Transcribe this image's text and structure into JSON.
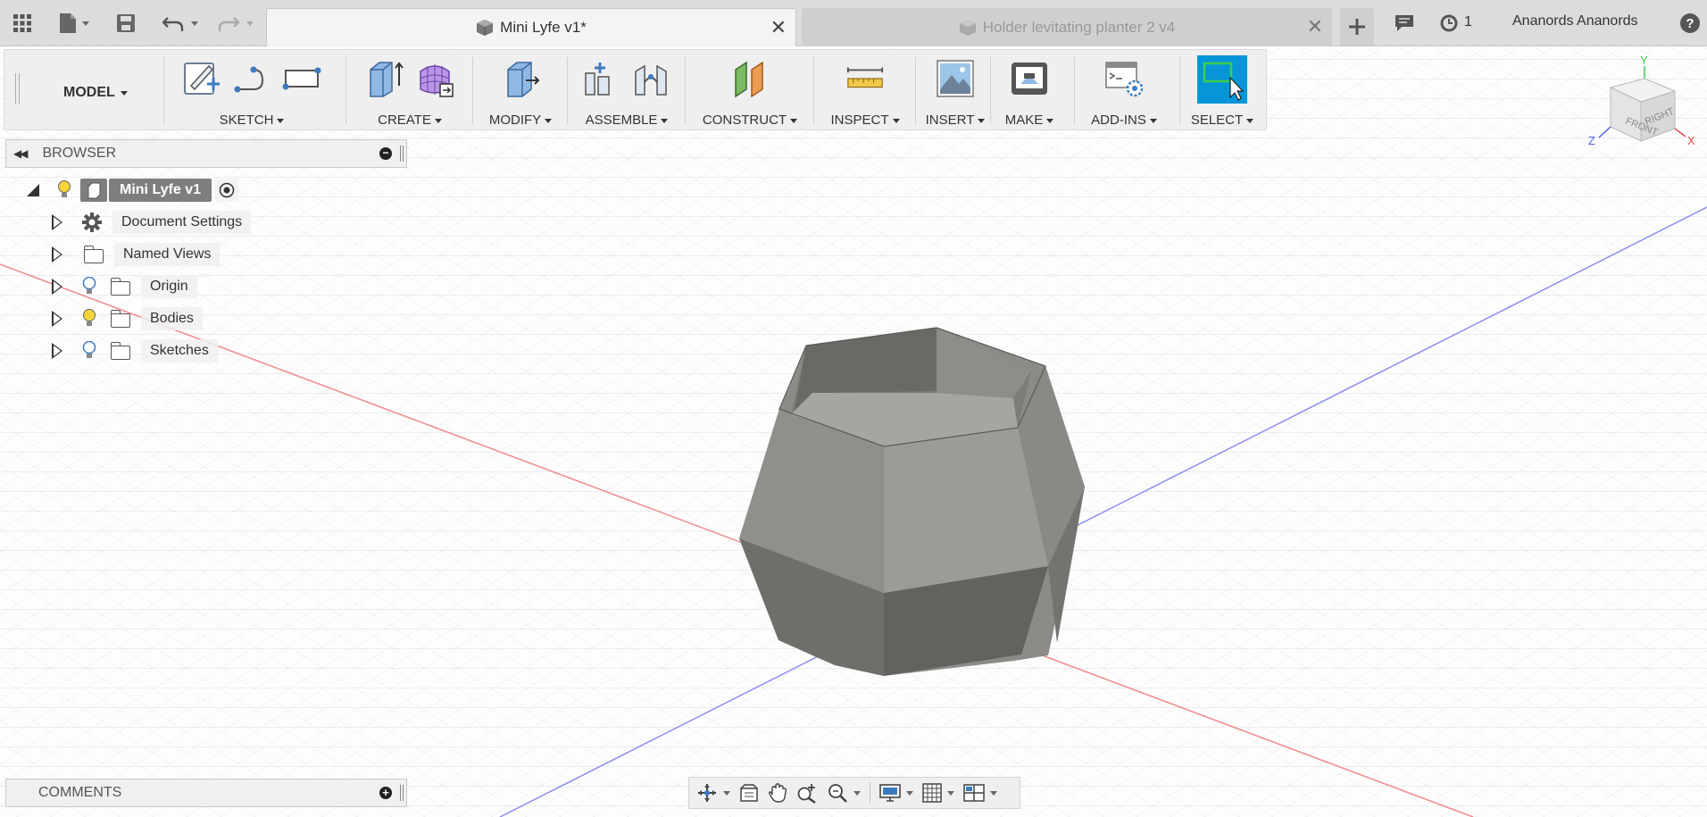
{
  "titlebar": {
    "tabs": [
      {
        "label": "Mini Lyfe v1*",
        "active": true
      },
      {
        "label": "Holder levitating planter 2 v4",
        "active": false
      }
    ],
    "jobs_count": "1",
    "user_name": "Ananords Ananords",
    "help": "?"
  },
  "toolbar": {
    "workspace": "MODEL",
    "groups": [
      {
        "label": "SKETCH"
      },
      {
        "label": "CREATE"
      },
      {
        "label": "MODIFY"
      },
      {
        "label": "ASSEMBLE"
      },
      {
        "label": "CONSTRUCT"
      },
      {
        "label": "INSPECT"
      },
      {
        "label": "INSERT"
      },
      {
        "label": "MAKE"
      },
      {
        "label": "ADD-INS"
      },
      {
        "label": "SELECT"
      }
    ]
  },
  "browser": {
    "title": "BROWSER",
    "root": "Mini Lyfe v1",
    "items": [
      {
        "label": "Document Settings"
      },
      {
        "label": "Named Views"
      },
      {
        "label": "Origin"
      },
      {
        "label": "Bodies"
      },
      {
        "label": "Sketches"
      }
    ]
  },
  "comments": {
    "title": "COMMENTS"
  },
  "viewcube": {
    "front": "FRONT",
    "right": "RIGHT",
    "axis_x": "X",
    "axis_y": "Y",
    "axis_z": "Z"
  },
  "colors": {
    "accent": "#0696d7",
    "select_active": "#0696d7",
    "body": "#8b8a86"
  }
}
